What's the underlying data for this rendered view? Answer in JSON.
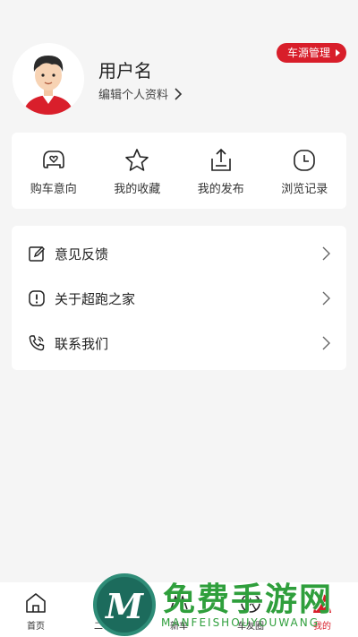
{
  "profile": {
    "username": "用户名",
    "edit_label": "编辑个人资料",
    "source_button": "车源管理"
  },
  "quick_actions": [
    {
      "label": "购车意向",
      "icon": "car-heart-icon"
    },
    {
      "label": "我的收藏",
      "icon": "star-icon"
    },
    {
      "label": "我的发布",
      "icon": "upload-icon"
    },
    {
      "label": "浏览记录",
      "icon": "clock-icon"
    }
  ],
  "menu": [
    {
      "label": "意见反馈",
      "icon": "edit-icon"
    },
    {
      "label": "关于超跑之家",
      "icon": "info-icon"
    },
    {
      "label": "联系我们",
      "icon": "phone-icon"
    }
  ],
  "tabbar": [
    {
      "label": "首页",
      "icon": "home-icon"
    },
    {
      "label": "二手车",
      "icon": "car-icon"
    },
    {
      "label": "新车",
      "icon": "new-car-icon"
    },
    {
      "label": "车友圈",
      "icon": "aperture-icon"
    },
    {
      "label": "我的",
      "icon": "person-icon",
      "active": true
    }
  ],
  "watermark": {
    "logo_letter": "M",
    "title": "免费手游网",
    "subtitle": "MANFEISHOUYOUWANG"
  },
  "colors": {
    "accent": "#d81e2a",
    "background": "#f5f5f5"
  }
}
